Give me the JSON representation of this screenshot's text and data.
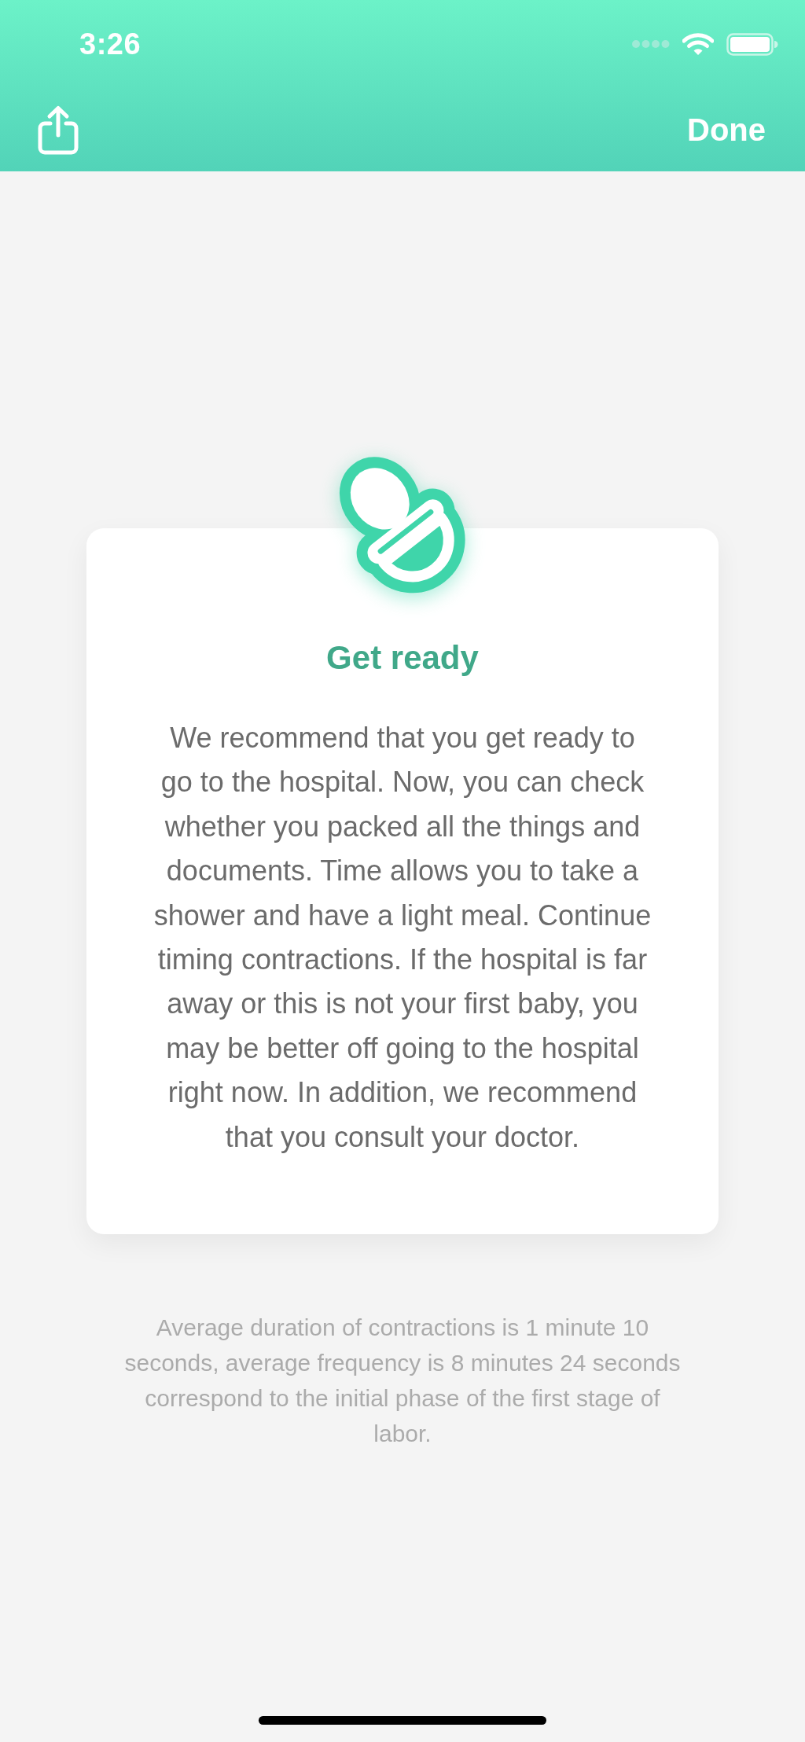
{
  "status_bar": {
    "time": "3:26"
  },
  "nav_bar": {
    "done": "Done"
  },
  "card": {
    "title": "Get ready",
    "body": "We recommend that you get ready to go to the hospital. Now, you can check whether you packed all the things and documents. Time allows you to take a shower and have a light meal. Continue timing contractions. If the hospital is far away or this is not your first baby, you may be better off going to the hospital right now. In addition, we recommend that you consult your doctor."
  },
  "summary": "Average duration of contractions is 1 minute 10 seconds, average frequency is 8 minutes 24 seconds correspond to the initial phase of the first stage of labor."
}
